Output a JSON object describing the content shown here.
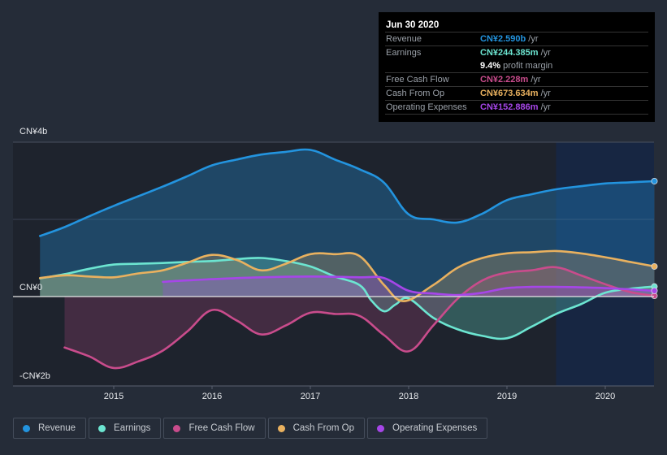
{
  "tooltip": {
    "date": "Jun 30 2020",
    "rows": [
      {
        "label": "Revenue",
        "value": "CN¥2.590b",
        "unit": "/yr",
        "color": "#2394df"
      },
      {
        "label": "Earnings",
        "value": "CN¥244.385m",
        "unit": "/yr",
        "color": "#6ce5d1"
      },
      {
        "label": "",
        "value": "9.4%",
        "unit": "profit margin",
        "color": "#ffffff"
      },
      {
        "label": "Free Cash Flow",
        "value": "CN¥2.228m",
        "unit": "/yr",
        "color": "#c94c8c"
      },
      {
        "label": "Cash From Op",
        "value": "CN¥673.634m",
        "unit": "/yr",
        "color": "#e9b15f"
      },
      {
        "label": "Operating Expenses",
        "value": "CN¥152.886m",
        "unit": "/yr",
        "color": "#a646e8"
      }
    ]
  },
  "legend": [
    {
      "label": "Revenue",
      "color": "#2394df"
    },
    {
      "label": "Earnings",
      "color": "#6ce5d1"
    },
    {
      "label": "Free Cash Flow",
      "color": "#c94c8c"
    },
    {
      "label": "Cash From Op",
      "color": "#e9b15f"
    },
    {
      "label": "Operating Expenses",
      "color": "#a646e8"
    }
  ],
  "chart_data": {
    "type": "area",
    "title": "",
    "xlabel": "",
    "ylabel": "",
    "y_unit": "CN¥ billions",
    "ylim": [
      -2.3,
      4.0
    ],
    "xlim": [
      2014.25,
      2020.5
    ],
    "y_tick_labels": [
      {
        "value": 4,
        "label": "CN¥4b"
      },
      {
        "value": 0,
        "label": "CN¥0"
      },
      {
        "value": -2,
        "label": "-CN¥2b"
      }
    ],
    "x_tick_labels": [
      "2015",
      "2016",
      "2017",
      "2018",
      "2019",
      "2020"
    ],
    "x_ticks": [
      2015,
      2016,
      2017,
      2018,
      2019,
      2020
    ],
    "gridlines": [
      4,
      2,
      0
    ],
    "forecast_shade_start": 2019.5,
    "legend_position": "bottom-left",
    "series": [
      {
        "name": "Revenue",
        "color": "#2394df",
        "x": [
          2014.25,
          2014.5,
          2014.75,
          2015.0,
          2015.25,
          2015.5,
          2015.75,
          2016.0,
          2016.25,
          2016.5,
          2016.75,
          2017.0,
          2017.25,
          2017.5,
          2017.75,
          2018.0,
          2018.25,
          2018.5,
          2018.75,
          2019.0,
          2019.25,
          2019.5,
          2019.75,
          2020.0,
          2020.25,
          2020.5
        ],
        "values": [
          1.57,
          1.8,
          2.08,
          2.35,
          2.6,
          2.85,
          3.12,
          3.4,
          3.55,
          3.68,
          3.75,
          3.8,
          3.55,
          3.3,
          2.95,
          2.13,
          2.0,
          1.92,
          2.15,
          2.5,
          2.65,
          2.78,
          2.86,
          2.93,
          2.96,
          2.99
        ]
      },
      {
        "name": "Earnings",
        "color": "#6ce5d1",
        "x": [
          2014.25,
          2014.5,
          2014.75,
          2015.0,
          2015.25,
          2015.5,
          2015.75,
          2016.0,
          2016.25,
          2016.5,
          2016.75,
          2017.0,
          2017.25,
          2017.5,
          2017.62,
          2017.75,
          2017.87,
          2018.0,
          2018.25,
          2018.5,
          2018.75,
          2019.0,
          2019.25,
          2019.5,
          2019.75,
          2020.0,
          2020.25,
          2020.5
        ],
        "values": [
          0.47,
          0.58,
          0.72,
          0.83,
          0.85,
          0.87,
          0.9,
          0.92,
          0.97,
          1.0,
          0.92,
          0.78,
          0.52,
          0.3,
          -0.1,
          -0.38,
          -0.2,
          -0.05,
          -0.55,
          -0.85,
          -1.02,
          -1.08,
          -0.78,
          -0.45,
          -0.2,
          0.1,
          0.2,
          0.26
        ]
      },
      {
        "name": "Free Cash Flow",
        "color": "#c94c8c",
        "x": [
          2014.5,
          2014.75,
          2015.0,
          2015.25,
          2015.5,
          2015.75,
          2016.0,
          2016.25,
          2016.5,
          2016.75,
          2017.0,
          2017.25,
          2017.5,
          2017.75,
          2018.0,
          2018.25,
          2018.5,
          2018.75,
          2019.0,
          2019.25,
          2019.5,
          2019.75,
          2020.0,
          2020.25,
          2020.5
        ],
        "values": [
          -1.32,
          -1.55,
          -1.85,
          -1.68,
          -1.4,
          -0.9,
          -0.35,
          -0.62,
          -0.98,
          -0.75,
          -0.42,
          -0.45,
          -0.5,
          -1.0,
          -1.42,
          -0.75,
          -0.05,
          0.42,
          0.62,
          0.68,
          0.76,
          0.55,
          0.32,
          0.12,
          0.02
        ]
      },
      {
        "name": "Cash From Op",
        "color": "#e9b15f",
        "x": [
          2014.25,
          2014.5,
          2014.75,
          2015.0,
          2015.25,
          2015.5,
          2015.75,
          2016.0,
          2016.25,
          2016.5,
          2016.75,
          2017.0,
          2017.25,
          2017.5,
          2017.75,
          2017.95,
          2018.25,
          2018.5,
          2018.75,
          2019.0,
          2019.25,
          2019.5,
          2019.75,
          2020.0,
          2020.25,
          2020.5
        ],
        "values": [
          0.48,
          0.55,
          0.52,
          0.5,
          0.6,
          0.68,
          0.88,
          1.08,
          0.95,
          0.68,
          0.85,
          1.1,
          1.1,
          1.05,
          0.3,
          -0.12,
          0.3,
          0.75,
          1.0,
          1.12,
          1.15,
          1.18,
          1.12,
          1.02,
          0.9,
          0.78
        ]
      },
      {
        "name": "Operating Expenses",
        "color": "#a646e8",
        "x": [
          2015.5,
          2015.75,
          2016.0,
          2016.5,
          2017.0,
          2017.5,
          2017.75,
          2018.0,
          2018.25,
          2018.5,
          2018.75,
          2019.0,
          2019.25,
          2019.5,
          2020.0,
          2020.5
        ],
        "values": [
          0.38,
          0.42,
          0.45,
          0.5,
          0.52,
          0.5,
          0.48,
          0.15,
          0.08,
          0.04,
          0.1,
          0.22,
          0.25,
          0.25,
          0.22,
          0.15
        ]
      }
    ]
  }
}
